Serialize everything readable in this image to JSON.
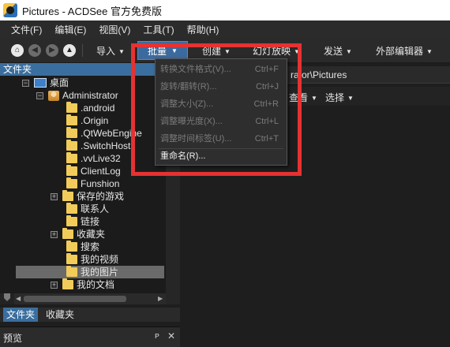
{
  "window": {
    "title": "Pictures - ACDSee 官方免费版"
  },
  "menubar": [
    "文件(F)",
    "编辑(E)",
    "视图(V)",
    "工具(T)",
    "帮助(H)"
  ],
  "toolbar": {
    "import": "导入",
    "batch": "批量",
    "create": "创建",
    "slideshow": "幻灯放映",
    "send": "发送",
    "external_editor": "外部编辑器"
  },
  "batch_menu": [
    {
      "label": "转换文件格式(V)...",
      "shortcut": "Ctrl+F",
      "enabled": false
    },
    {
      "label": "旋转/翻转(R)...",
      "shortcut": "Ctrl+J",
      "enabled": false
    },
    {
      "label": "调整大小(Z)...",
      "shortcut": "Ctrl+R",
      "enabled": false
    },
    {
      "label": "调整曝光度(X)...",
      "shortcut": "Ctrl+L",
      "enabled": false
    },
    {
      "label": "调整时间标签(U)...",
      "shortcut": "Ctrl+T",
      "enabled": false
    },
    {
      "label": "重命名(R)...",
      "shortcut": "",
      "enabled": true
    }
  ],
  "left_panel": {
    "header": "文件夹",
    "tree": [
      {
        "label": "桌面",
        "icon": "desktop-icon"
      },
      {
        "label": "Administrator",
        "icon": "user-folder-icon"
      },
      {
        "label": ".android",
        "icon": "folder-icon"
      },
      {
        "label": ".Origin",
        "icon": "folder-icon"
      },
      {
        "label": ".QtWebEngine",
        "icon": "folder-icon"
      },
      {
        "label": ".SwitchHosts",
        "icon": "folder-icon"
      },
      {
        "label": ".vvLive32",
        "icon": "folder-icon"
      },
      {
        "label": "ClientLog",
        "icon": "folder-icon"
      },
      {
        "label": "Funshion",
        "icon": "folder-icon"
      },
      {
        "label": "保存的游戏",
        "icon": "folder-icon"
      },
      {
        "label": "联系人",
        "icon": "contacts-icon"
      },
      {
        "label": "链接",
        "icon": "links-icon"
      },
      {
        "label": "收藏夹",
        "icon": "favorites-icon"
      },
      {
        "label": "搜索",
        "icon": "search-folder-icon"
      },
      {
        "label": "我的视频",
        "icon": "videos-icon"
      },
      {
        "label": "我的图片",
        "icon": "pictures-icon",
        "selected": true
      },
      {
        "label": "我的文档",
        "icon": "documents-icon"
      }
    ],
    "tabs": [
      "文件夹",
      "收藏夹"
    ]
  },
  "preview": {
    "label": "预览"
  },
  "right": {
    "path": "rator\\Pictures",
    "view": "查看",
    "select": "选择"
  },
  "colors": {
    "accent": "#3a6e9e",
    "highlight_box": "#e53232",
    "folder": "#f2cc5a"
  }
}
